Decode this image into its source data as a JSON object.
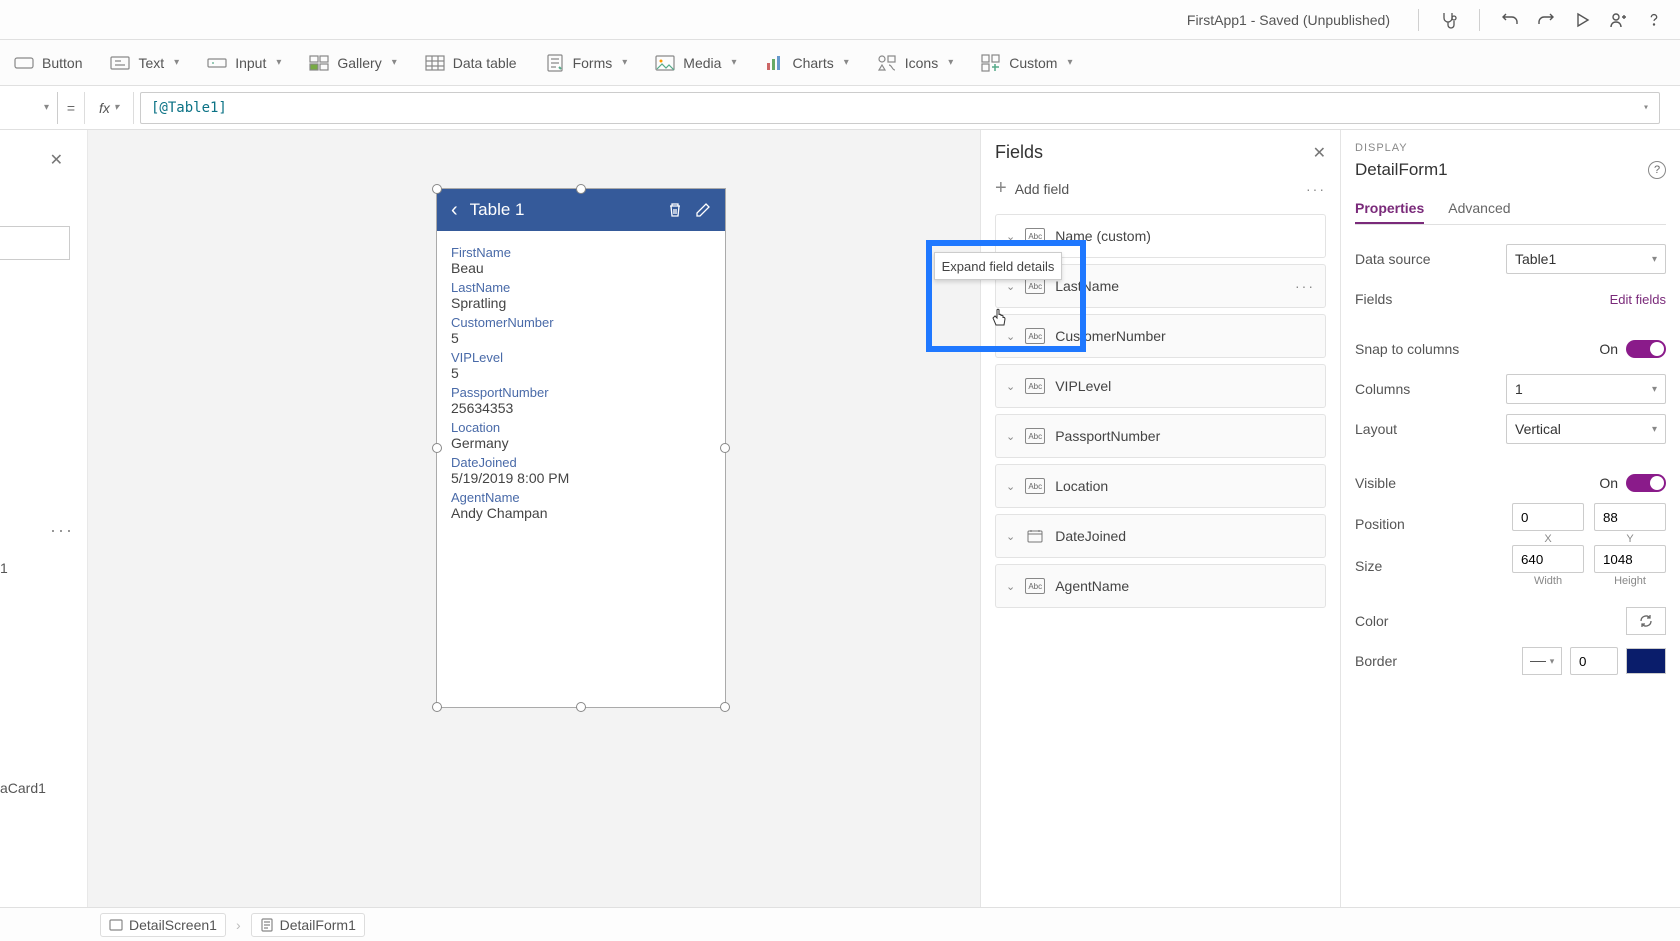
{
  "header": {
    "title": "FirstApp1 - Saved (Unpublished)"
  },
  "ribbon": {
    "button": "Button",
    "text": "Text",
    "input": "Input",
    "gallery": "Gallery",
    "datatable": "Data table",
    "forms": "Forms",
    "media": "Media",
    "charts": "Charts",
    "icons": "Icons",
    "custom": "Custom"
  },
  "fx": {
    "equals": "=",
    "fx": "fx",
    "formula": "[@Table1]"
  },
  "left": {
    "stub1": "1",
    "stub2": "aCard1"
  },
  "phone": {
    "title": "Table 1",
    "records": [
      {
        "label": "FirstName",
        "value": "Beau"
      },
      {
        "label": "LastName",
        "value": "Spratling"
      },
      {
        "label": "CustomerNumber",
        "value": "5"
      },
      {
        "label": "VIPLevel",
        "value": "5"
      },
      {
        "label": "PassportNumber",
        "value": "25634353"
      },
      {
        "label": "Location",
        "value": "Germany"
      },
      {
        "label": "DateJoined",
        "value": "5/19/2019 8:00 PM"
      },
      {
        "label": "AgentName",
        "value": "Andy Champan"
      }
    ]
  },
  "fields": {
    "title": "Fields",
    "add": "Add field",
    "tooltip": "Expand field details",
    "items": [
      {
        "name": "Name (custom)",
        "type": "abc"
      },
      {
        "name": "LastName",
        "type": "abc"
      },
      {
        "name": "CustomerNumber",
        "type": "abc"
      },
      {
        "name": "VIPLevel",
        "type": "abc"
      },
      {
        "name": "PassportNumber",
        "type": "abc"
      },
      {
        "name": "Location",
        "type": "abc"
      },
      {
        "name": "DateJoined",
        "type": "date"
      },
      {
        "name": "AgentName",
        "type": "abc"
      }
    ]
  },
  "props": {
    "sectionLabel": "DISPLAY",
    "object": "DetailForm1",
    "tabs": {
      "properties": "Properties",
      "advanced": "Advanced"
    },
    "datasource": {
      "label": "Data source",
      "value": "Table1"
    },
    "fields": {
      "label": "Fields",
      "edit": "Edit fields"
    },
    "snap": {
      "label": "Snap to columns",
      "on": "On"
    },
    "columns": {
      "label": "Columns",
      "value": "1"
    },
    "layout": {
      "label": "Layout",
      "value": "Vertical"
    },
    "visible": {
      "label": "Visible",
      "on": "On"
    },
    "position": {
      "label": "Position",
      "x": "0",
      "y": "88",
      "xl": "X",
      "yl": "Y"
    },
    "size": {
      "label": "Size",
      "w": "640",
      "h": "1048",
      "wl": "Width",
      "hl": "Height"
    },
    "color": {
      "label": "Color"
    },
    "border": {
      "label": "Border",
      "value": "0",
      "color": "#0a1d6b"
    }
  },
  "footer": {
    "screen": "DetailScreen1",
    "form": "DetailForm1"
  }
}
